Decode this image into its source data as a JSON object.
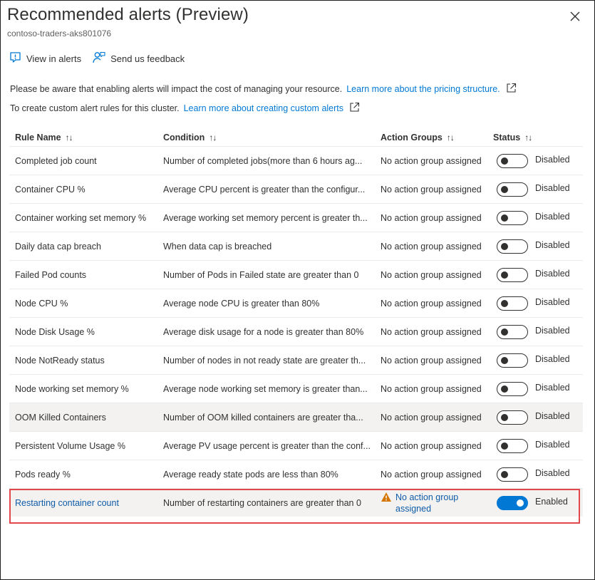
{
  "panel": {
    "title": "Recommended alerts (Preview)",
    "subtitle": "contoso-traders-aks801076"
  },
  "toolbar": {
    "view_in_alerts": "View in alerts",
    "send_feedback": "Send us feedback"
  },
  "info": {
    "line1_text": "Please be aware that enabling alerts will impact the cost of managing your resource.",
    "line1_link": "Learn more about the pricing structure.",
    "line2_text": "To create custom alert rules for this cluster.",
    "line2_link": "Learn more about creating custom alerts"
  },
  "table": {
    "headers": {
      "rule_name": "Rule Name",
      "condition": "Condition",
      "action_groups": "Action Groups",
      "status": "Status",
      "sort_glyph": "↑↓"
    },
    "rows": [
      {
        "name": "Completed job count",
        "condition": "Number of completed jobs(more than 6 hours ag...",
        "action_group": "No action group assigned",
        "status": "Disabled"
      },
      {
        "name": "Container CPU %",
        "condition": "Average CPU percent is greater than the configur...",
        "action_group": "No action group assigned",
        "status": "Disabled"
      },
      {
        "name": "Container working set memory %",
        "condition": "Average working set memory percent is greater th...",
        "action_group": "No action group assigned",
        "status": "Disabled"
      },
      {
        "name": "Daily data cap breach",
        "condition": "When data cap is breached",
        "action_group": "No action group assigned",
        "status": "Disabled"
      },
      {
        "name": "Failed Pod counts",
        "condition": "Number of Pods in Failed state are greater than 0",
        "action_group": "No action group assigned",
        "status": "Disabled"
      },
      {
        "name": "Node CPU %",
        "condition": "Average node CPU is greater than 80%",
        "action_group": "No action group assigned",
        "status": "Disabled"
      },
      {
        "name": "Node Disk Usage %",
        "condition": "Average disk usage for a node is greater than 80%",
        "action_group": "No action group assigned",
        "status": "Disabled"
      },
      {
        "name": "Node NotReady status",
        "condition": "Number of nodes in not ready state are greater th...",
        "action_group": "No action group assigned",
        "status": "Disabled"
      },
      {
        "name": "Node working set memory %",
        "condition": "Average node working set memory is greater than...",
        "action_group": "No action group assigned",
        "status": "Disabled"
      },
      {
        "name": "OOM Killed Containers",
        "condition": "Number of OOM killed containers are greater tha...",
        "action_group": "No action group assigned",
        "status": "Disabled"
      },
      {
        "name": "Persistent Volume Usage %",
        "condition": "Average PV usage percent is greater than the conf...",
        "action_group": "No action group assigned",
        "status": "Disabled"
      },
      {
        "name": "Pods ready %",
        "condition": "Average ready state pods are less than 80%",
        "action_group": "No action group assigned",
        "status": "Disabled"
      }
    ],
    "highlighted_row": {
      "name": "Restarting container count",
      "condition": "Number of restarting containers are greater than 0",
      "action_group_line1": "No action group",
      "action_group_line2": "assigned",
      "status": "Enabled"
    }
  },
  "colors": {
    "accent": "#0078d4",
    "link": "#0f5ca8",
    "highlight_border": "#e0484c",
    "warning": "#d47500"
  }
}
